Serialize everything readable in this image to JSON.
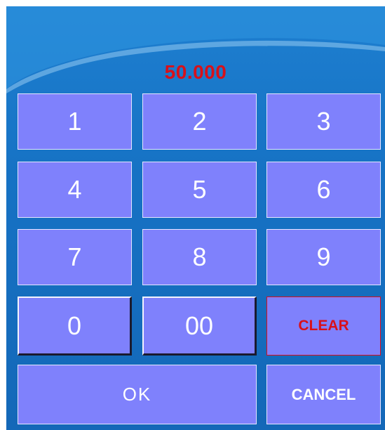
{
  "display": {
    "value": "50.000"
  },
  "keypad": {
    "k1": "1",
    "k2": "2",
    "k3": "3",
    "k4": "4",
    "k5": "5",
    "k6": "6",
    "k7": "7",
    "k8": "8",
    "k9": "9",
    "k0": "0",
    "k00": "00",
    "clear": "CLEAR",
    "ok": "OK",
    "cancel": "CANCEL"
  },
  "colors": {
    "panel": "#1672c4",
    "key": "#7f81fc",
    "display_text": "#d8101a",
    "clear_text": "#d8101a"
  }
}
